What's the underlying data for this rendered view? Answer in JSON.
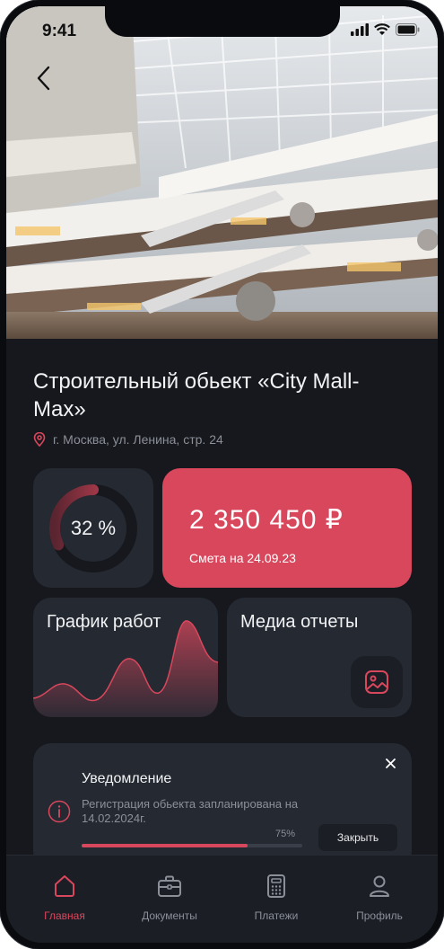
{
  "status_bar": {
    "time": "9:41"
  },
  "header": {
    "back_icon": "chevron-left-icon"
  },
  "project": {
    "title": "Строительный обьект  «City Mall-Max»",
    "address": "г. Москва, ул. Ленина, стр. 24"
  },
  "progress": {
    "value": 0.32,
    "label": "32 %"
  },
  "budget": {
    "amount": "2 350 450 ₽",
    "subtitle": "Смета на 24.09.23"
  },
  "schedule": {
    "title": "График работ"
  },
  "media": {
    "title": "Медиа отчеты",
    "icon": "image-icon"
  },
  "notification": {
    "title": "Уведомление",
    "text": "Регистрация обьекта запланирована на 14.02.2024г.",
    "progress_value": 0.75,
    "progress_label": "75%",
    "close_button": "Закрыть"
  },
  "tabbar": {
    "tabs": [
      {
        "label": "Главная",
        "icon": "home-icon",
        "active": true
      },
      {
        "label": "Документы",
        "icon": "briefcase-icon",
        "active": false
      },
      {
        "label": "Платежи",
        "icon": "calculator-icon",
        "active": false
      },
      {
        "label": "Профиль",
        "icon": "user-icon",
        "active": false
      }
    ]
  },
  "colors": {
    "accent": "#d9475c",
    "background": "#16181d",
    "card": "#252932"
  }
}
